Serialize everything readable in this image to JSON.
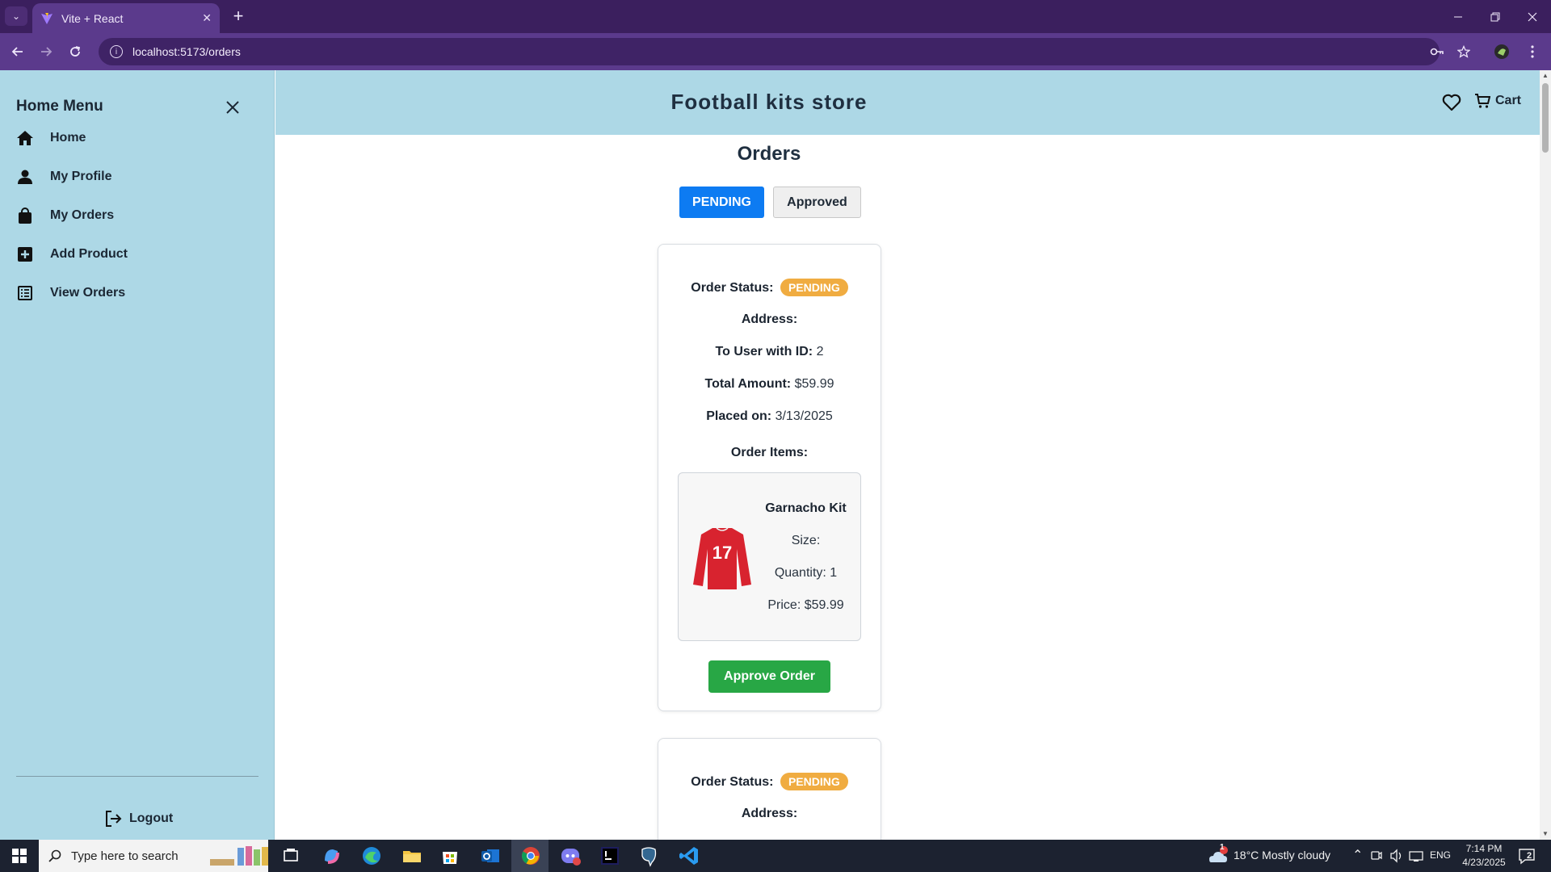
{
  "browser": {
    "tab_title": "Vite + React",
    "tab_close": "✕",
    "new_tab": "+",
    "url": "localhost:5173/orders"
  },
  "sidebar": {
    "title": "Home Menu",
    "items": [
      {
        "label": "Home",
        "icon": "home-icon"
      },
      {
        "label": "My Profile",
        "icon": "user-icon"
      },
      {
        "label": "My Orders",
        "icon": "shopping-bag-icon"
      },
      {
        "label": "Add Product",
        "icon": "plus-square-icon"
      },
      {
        "label": "View Orders",
        "icon": "list-icon"
      }
    ],
    "logout_label": "Logout"
  },
  "header": {
    "store_title": "Football kits store",
    "cart_label": "Cart"
  },
  "main": {
    "page_title": "Orders",
    "tabs": {
      "pending_label": "PENDING",
      "approved_label": "Approved"
    },
    "orders": [
      {
        "status_label": "Order Status:",
        "status": "PENDING",
        "address_label": "Address:",
        "user_label": "To User with ID:",
        "user_id": "2",
        "total_label": "Total Amount:",
        "total": "$59.99",
        "placed_label": "Placed on:",
        "placed_on": "3/13/2025",
        "items_label": "Order Items:",
        "items": [
          {
            "name": "Garnacho Kit",
            "size": "Size:",
            "quantity": "Quantity: 1",
            "price": "Price: $59.99"
          }
        ],
        "approve_label": "Approve Order"
      },
      {
        "status_label": "Order Status:",
        "status": "PENDING",
        "address_label": "Address:"
      }
    ],
    "jersey_number": "17"
  },
  "taskbar": {
    "search_placeholder": "Type here to search",
    "weather": "18°C  Mostly cloudy",
    "language": "ENG",
    "time": "7:14 PM",
    "date": "4/23/2025",
    "notification_count": "2",
    "weather_badge": "1"
  },
  "colors": {
    "sidebar_bg": "#add8e6",
    "pending_button": "#0d7bf2",
    "pending_badge": "#f0ac41",
    "approve_button": "#28a745",
    "browser_frame": "#5b3a8c"
  }
}
